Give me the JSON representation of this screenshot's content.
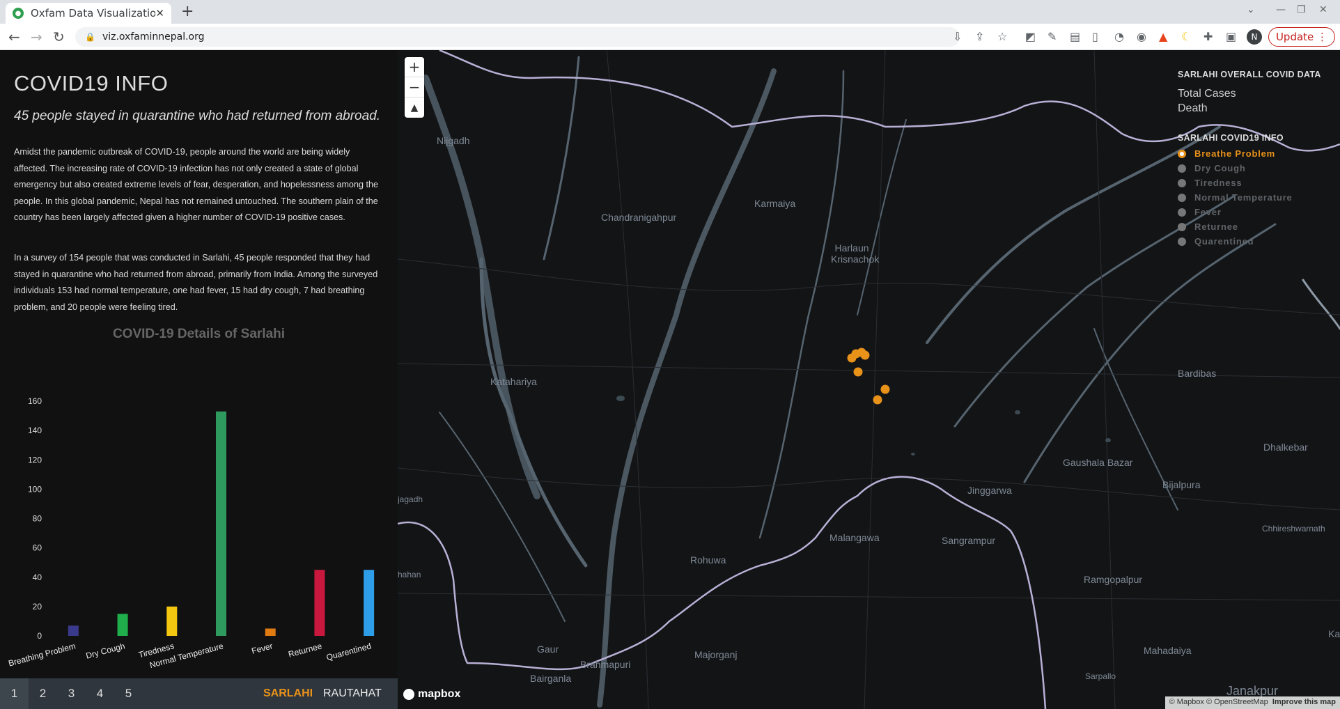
{
  "browser": {
    "tab_title": "Oxfam Data Visualization",
    "url": "viz.oxfaminnepal.org",
    "profile_initial": "N",
    "update_label": "Update"
  },
  "left": {
    "title": "COVID19 INFO",
    "subtitle": "45 people stayed in quarantine who had returned from abroad.",
    "paragraph1": "Amidst the pandemic outbreak of COVID-19, people around the world are being widely affected. The increasing rate of COVID-19 infection has not only created a state of global emergency but also created extreme levels of fear, desperation, and hopelessness among the people. In this global pandemic, Nepal has not remained untouched. The southern plain of the country has been largely affected given a higher number of COVID-19 positive cases.",
    "paragraph2": "In a survey of 154 people that was conducted in Sarlahi, 45 people responded that they had stayed in quarantine who had returned from abroad, primarily from India. Among the surveyed individuals 153 had normal temperature, one had fever, 15 had dry cough, 7 had breathing problem, and 20 people were feeling tired."
  },
  "chart_data": {
    "type": "bar",
    "title": "COVID-19 Details of Sarlahi",
    "categories": [
      "Breathing Problem",
      "Dry Cough",
      "Tiredness",
      "Normal Temperature",
      "Fever",
      "Returnee",
      "Quarentined"
    ],
    "values": [
      7,
      15,
      20,
      153,
      5,
      45,
      45
    ],
    "colors": [
      "#3a3a8c",
      "#1fae4b",
      "#f3c710",
      "#2f9a5e",
      "#e07b12",
      "#c8183d",
      "#2f9ee8"
    ],
    "ylim": [
      0,
      160
    ],
    "yticks": [
      "0",
      "20",
      "40",
      "60",
      "80",
      "100",
      "120",
      "140",
      "160"
    ],
    "xlabel": "",
    "ylabel": ""
  },
  "pager": {
    "pages": [
      "1",
      "2",
      "3",
      "4",
      "5"
    ],
    "active_page": "1",
    "regions": [
      "SARLAHI",
      "RAUTAHAT"
    ],
    "selected_region": "SARLAHI"
  },
  "map": {
    "zoom_in": "+",
    "zoom_out": "−",
    "compass": "▲",
    "towns": [
      "Nijgadh",
      "Chandranigahpur",
      "Karmaiya",
      "Harlaun Krisnachok",
      "Katahariya",
      "Bardibas",
      "Dhalkebar",
      "Gaushala Bazar",
      "Bijalpura",
      "Jinggarwa",
      "Chhireshwarnath",
      "Malangawa",
      "Sangrampur",
      "Rohuwa",
      "Ramgopalpur",
      "Gaur",
      "Brahmapuri",
      "Majorganj",
      "Mahadaiya",
      "Bairganla",
      "Sarpallo",
      "Janakpur",
      "Kara",
      "hahan",
      "jagadh"
    ],
    "logo": "mapbox",
    "attribution": "© Mapbox © OpenStreetMap",
    "improve_link": "Improve this map"
  },
  "legend": {
    "overall_heading": "SARLAHI OVERALL COVID DATA",
    "total_cases_label": "Total Cases",
    "death_label": "Death",
    "info_heading": "SARLAHI COVID19 INFO",
    "options": [
      "Breathe Problem",
      "Dry Cough",
      "Tiredness",
      "Normal Temperature",
      "Fever",
      "Returnee",
      "Quarentined"
    ],
    "selected_option": "Breathe Problem",
    "marker_color": "#e8921a"
  }
}
